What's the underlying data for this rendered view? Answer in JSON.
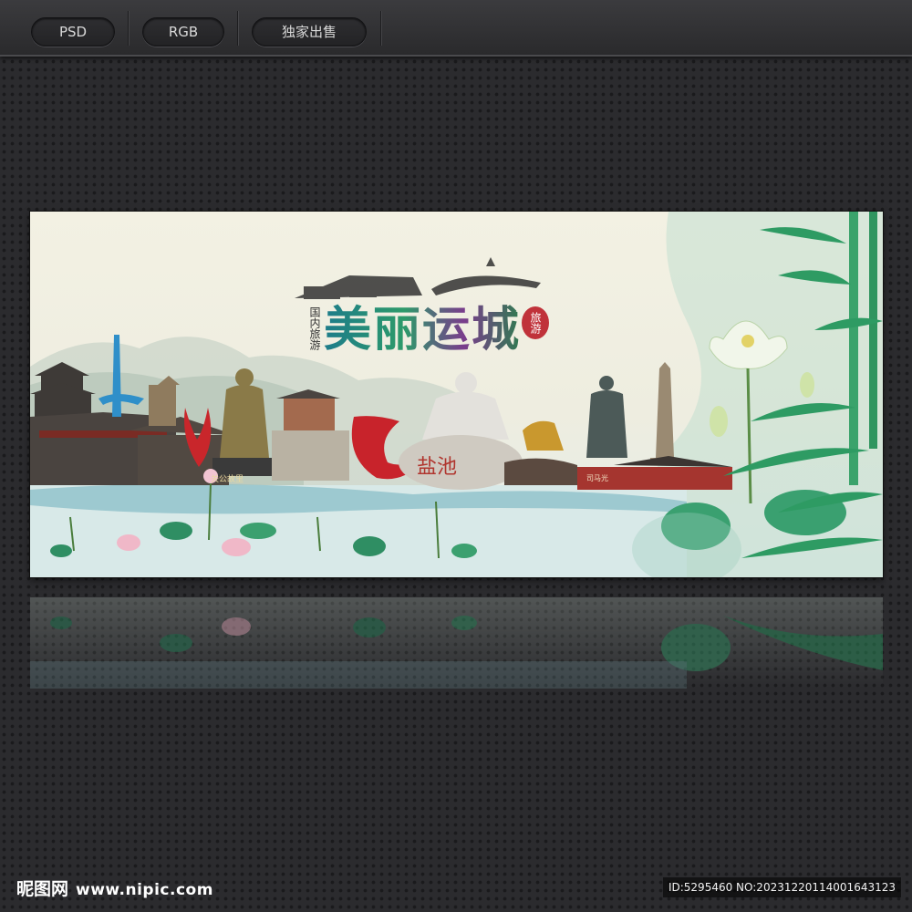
{
  "toolbar": {
    "tabs": [
      {
        "label": "PSD"
      },
      {
        "label": "RGB"
      },
      {
        "label": "独家出售"
      }
    ]
  },
  "poster": {
    "title": "美丽运城",
    "side_text": "国内旅游",
    "seal_text": "旅游",
    "rock_text": "盐池",
    "statue_plaque": "关公故里",
    "temple_plaque": "司马光"
  },
  "footer": {
    "logo_text": "昵图网",
    "site": "www.nipic.com",
    "id_text": "ID:5295460 NO:20231220114001643123"
  },
  "colors": {
    "background": "#2b2b2e",
    "toolbar": "#3b3b3e",
    "pill_text": "#d8d8d8",
    "poster_bg": "#f3f1e3",
    "seal": "#c0323a",
    "bamboo": "#2e9b63",
    "water": "#a9cfd6"
  },
  "icons": [
    "bamboo-graphic",
    "lotus-graphic",
    "pagoda-graphic",
    "statue-graphic",
    "phoenix-sculpture-graphic",
    "ink-village-graphic"
  ]
}
